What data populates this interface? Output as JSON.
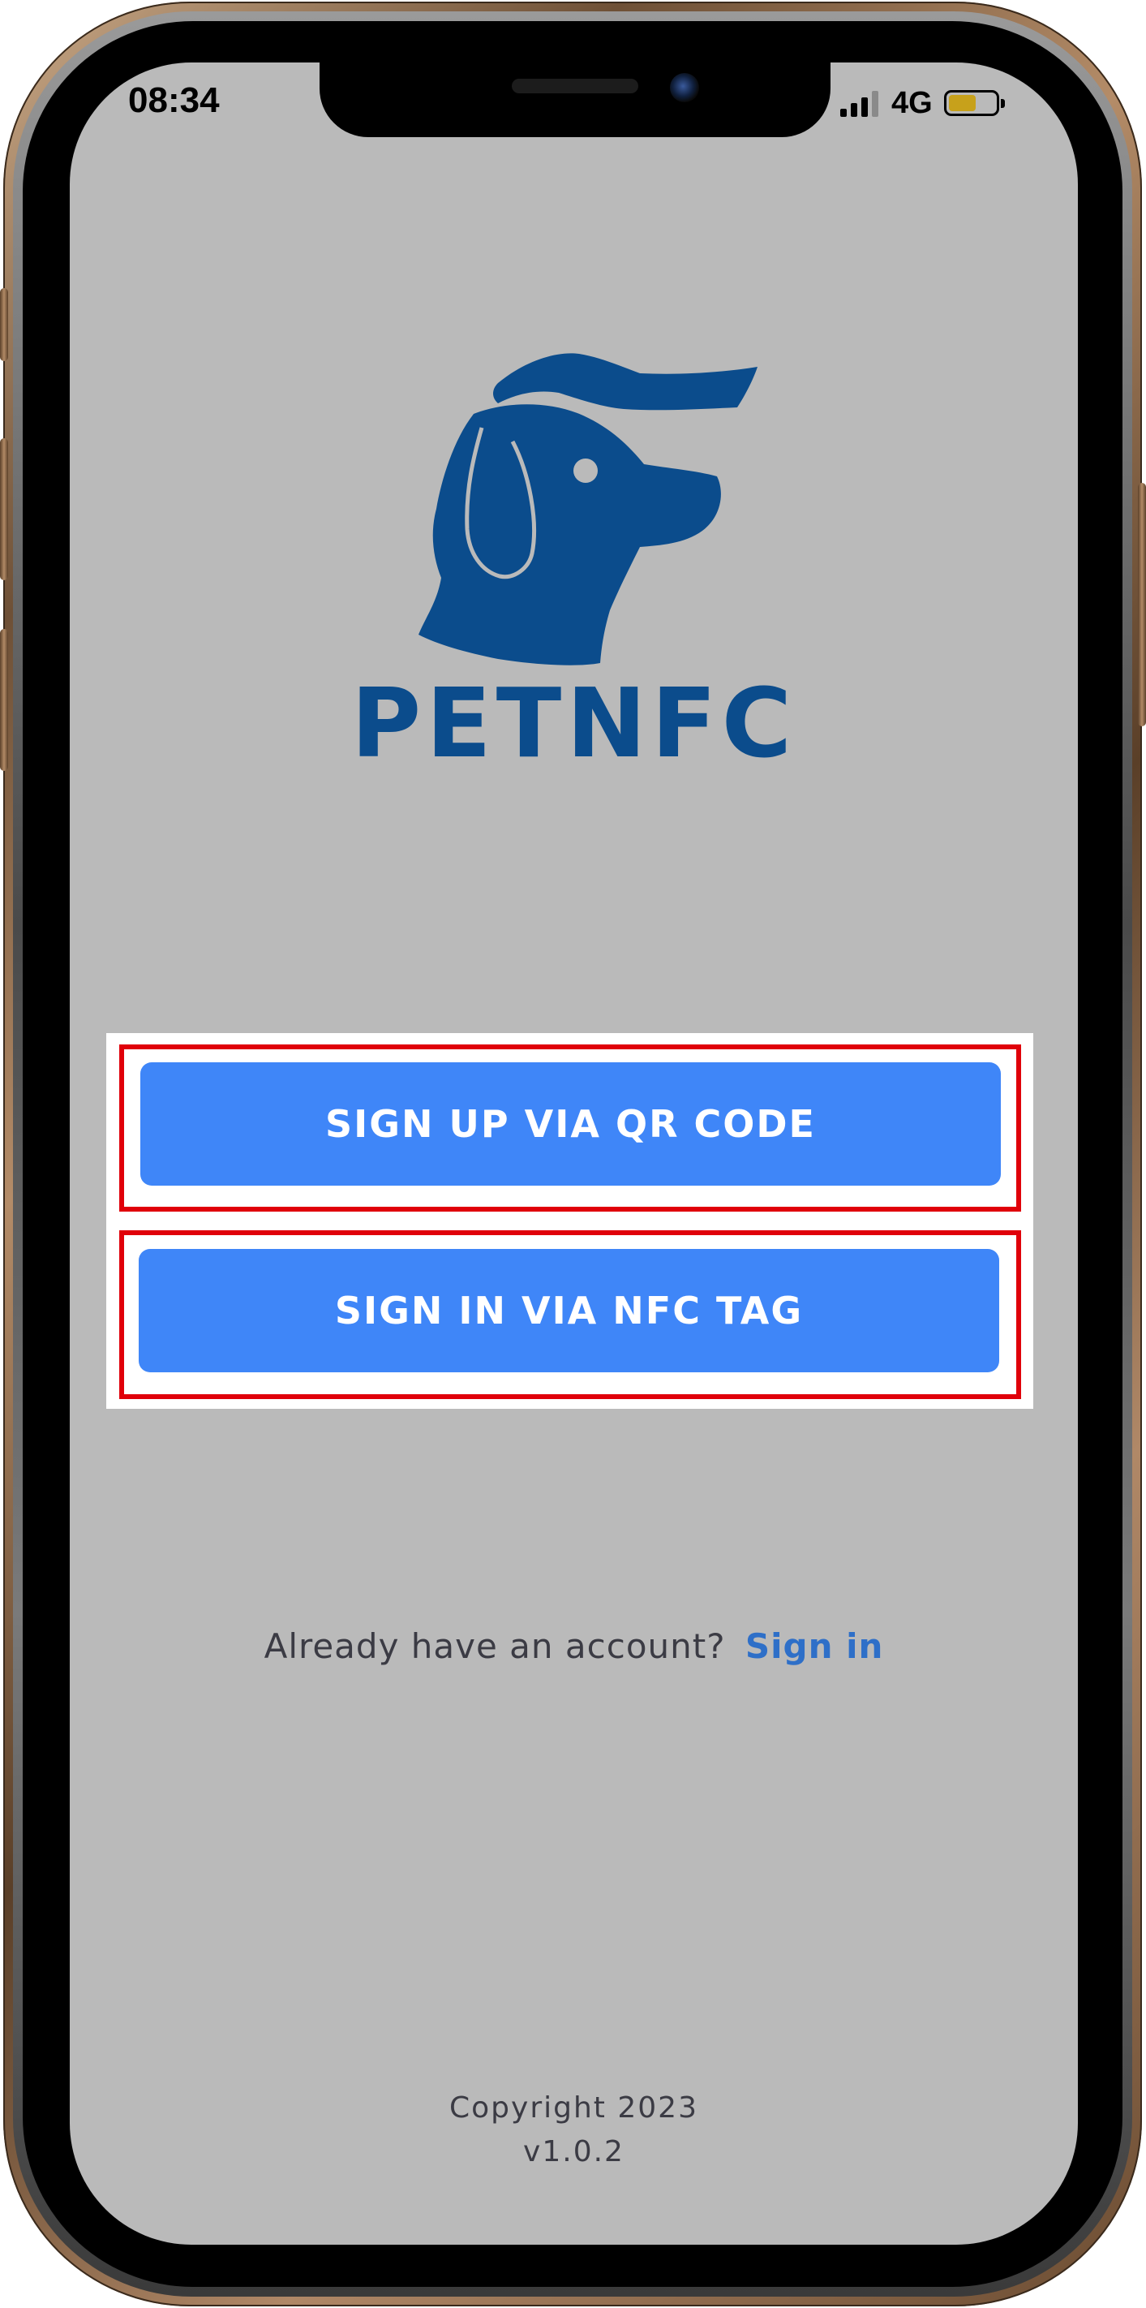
{
  "status_bar": {
    "time": "08:34",
    "network": "4G"
  },
  "logo": {
    "icon": "pet-hand-dog-logo",
    "brand_name": "PETNFC",
    "color": "#0b4c8c"
  },
  "actions": {
    "signup_qr_label": "SIGN UP VIA QR CODE",
    "signin_nfc_label": "SIGN IN VIA NFC TAG",
    "button_color": "#3f86f8",
    "highlight_color": "#e0000a"
  },
  "account_prompt": {
    "text": "Already have an account?",
    "link_label": "Sign in",
    "link_color": "#2e6fc8"
  },
  "footer": {
    "copyright": "Copyright 2023",
    "version": "v1.0.2"
  }
}
